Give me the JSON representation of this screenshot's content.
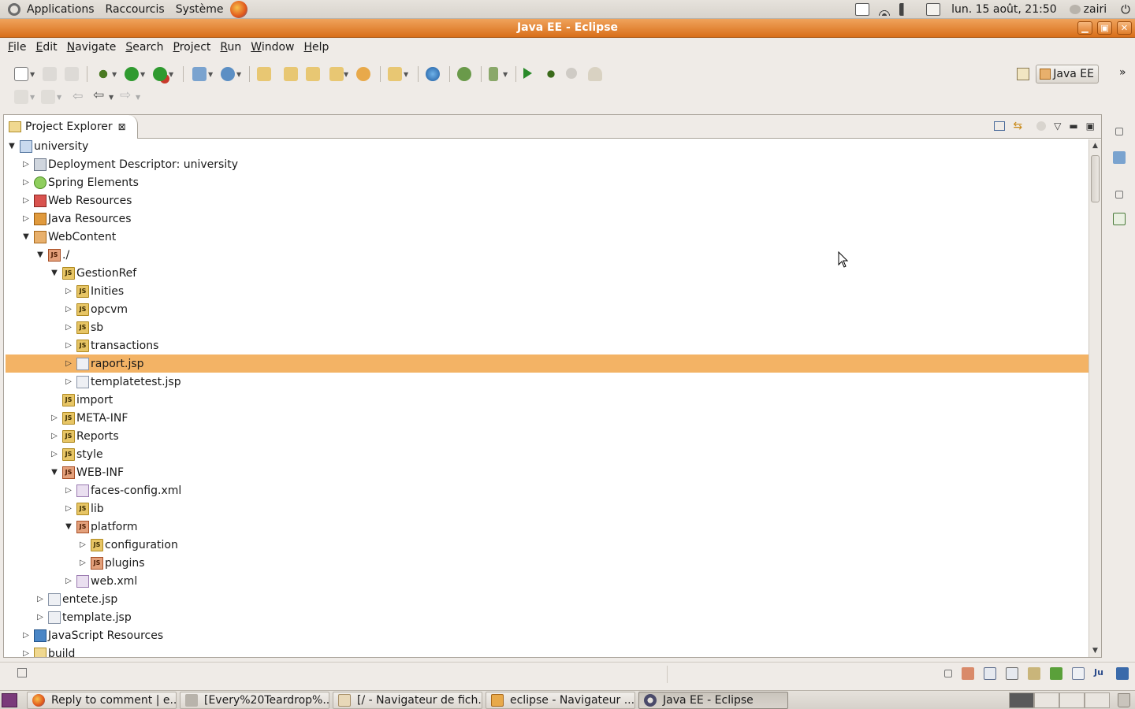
{
  "top_panel": {
    "menus": [
      "Applications",
      "Raccourcis",
      "Système"
    ],
    "clock": "lun. 15 août, 21:50",
    "user": "zairi"
  },
  "window": {
    "title": "Java EE - Eclipse"
  },
  "menubar": {
    "items": [
      {
        "first": "F",
        "rest": "ile"
      },
      {
        "first": "E",
        "rest": "dit"
      },
      {
        "first": "N",
        "rest": "avigate"
      },
      {
        "first": "S",
        "rest": "earch"
      },
      {
        "first": "P",
        "rest": "roject"
      },
      {
        "first": "R",
        "rest": "un"
      },
      {
        "first": "W",
        "rest": "indow"
      },
      {
        "first": "H",
        "rest": "elp"
      }
    ]
  },
  "perspective": {
    "label": "Java EE"
  },
  "view": {
    "tab_title": "Project Explorer",
    "tree": [
      {
        "label": "university",
        "expanded": true,
        "icon": "project-icon"
      },
      {
        "label": "Deployment Descriptor: university",
        "expanded": false,
        "icon": "deployment-descriptor-icon"
      },
      {
        "label": "Spring Elements",
        "expanded": false,
        "icon": "spring-icon"
      },
      {
        "label": "Web Resources",
        "expanded": false,
        "icon": "web-resources-icon"
      },
      {
        "label": "Java Resources",
        "expanded": false,
        "icon": "java-resources-icon"
      },
      {
        "label": "WebContent",
        "expanded": true,
        "icon": "webcontent-folder-icon"
      },
      {
        "label": "./",
        "expanded": true,
        "icon": "js-folder-error-icon"
      },
      {
        "label": "GestionRef",
        "expanded": true,
        "icon": "js-folder-icon"
      },
      {
        "label": "Inities",
        "expanded": false,
        "icon": "js-folder-icon"
      },
      {
        "label": "opcvm",
        "expanded": false,
        "icon": "js-folder-icon"
      },
      {
        "label": "sb",
        "expanded": false,
        "icon": "js-folder-icon"
      },
      {
        "label": "transactions",
        "expanded": false,
        "icon": "js-folder-icon"
      },
      {
        "label": "raport.jsp",
        "expanded": false,
        "icon": "jsp-file-icon"
      },
      {
        "label": "templatetest.jsp",
        "expanded": false,
        "icon": "jsp-file-icon"
      },
      {
        "label": "import",
        "expanded": null,
        "icon": "js-folder-icon"
      },
      {
        "label": "META-INF",
        "expanded": false,
        "icon": "js-folder-icon"
      },
      {
        "label": "Reports",
        "expanded": false,
        "icon": "js-folder-icon"
      },
      {
        "label": "style",
        "expanded": false,
        "icon": "js-folder-icon"
      },
      {
        "label": "WEB-INF",
        "expanded": true,
        "icon": "js-folder-error-icon"
      },
      {
        "label": "faces-config.xml",
        "expanded": false,
        "icon": "xml-file-icon"
      },
      {
        "label": "lib",
        "expanded": false,
        "icon": "js-folder-icon"
      },
      {
        "label": "platform",
        "expanded": true,
        "icon": "js-folder-error-icon"
      },
      {
        "label": "configuration",
        "expanded": false,
        "icon": "js-folder-icon"
      },
      {
        "label": "plugins",
        "expanded": false,
        "icon": "js-folder-error-icon"
      },
      {
        "label": "web.xml",
        "expanded": false,
        "icon": "xml-file-icon"
      },
      {
        "label": "entete.jsp",
        "expanded": false,
        "icon": "jsp-file-icon"
      },
      {
        "label": "template.jsp",
        "expanded": false,
        "icon": "jsp-file-icon"
      },
      {
        "label": "JavaScript Resources",
        "expanded": false,
        "icon": "js-resources-icon"
      },
      {
        "label": "build",
        "expanded": false,
        "icon": "folder-icon"
      }
    ],
    "selected_item": "raport.jsp"
  },
  "taskbar": {
    "tasks": [
      {
        "label": "Reply to comment | e...",
        "icon": "firefox-icon"
      },
      {
        "label": "[Every%20Teardrop%...",
        "icon": "document-icon"
      },
      {
        "label": "[/ - Navigateur de fich...",
        "icon": "folder-icon"
      },
      {
        "label": "eclipse - Navigateur ...",
        "icon": "folder-icon"
      },
      {
        "label": "Java EE - Eclipse",
        "icon": "eclipse-icon"
      }
    ]
  },
  "colors": {
    "titlebar": "#d96f1a",
    "selection": "#f3b365",
    "panel": "#dcd7d0"
  }
}
